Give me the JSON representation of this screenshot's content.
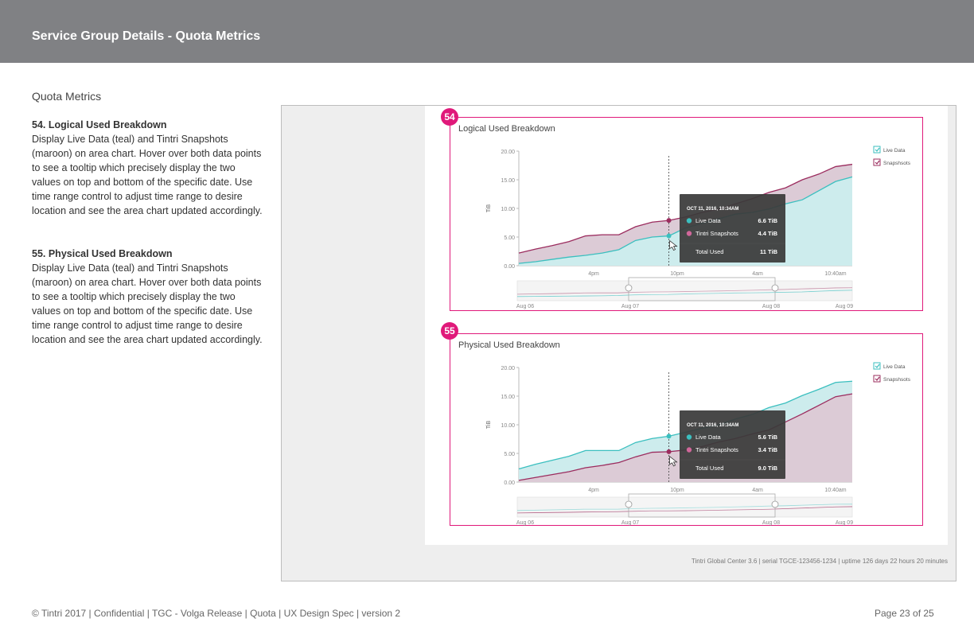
{
  "header": {
    "title": "Service Group Details - Quota Metrics"
  },
  "section_title": "Quota Metrics",
  "descriptions": [
    {
      "title": "54. Logical Used Breakdown",
      "body": "Display Live Data (teal) and Tintri Snapshots (maroon) on area chart. Hover over both data points to see a tooltip which precisely display the two values on top and bottom of the specific date. Use time range control to adjust time range to desire location and see the area chart updated accordingly."
    },
    {
      "title": "55. Physical Used Breakdown",
      "body": "Display Live Data (teal) and Tintri Snapshots (maroon) on area chart. Hover over both data points to see a tooltip which precisely display the two values on top and bottom of the specific date. Use time range control to adjust time range to desire location and see the area chart updated accordingly."
    }
  ],
  "colors": {
    "teal": "#3bbfbf",
    "teal_fill": "#cdeced",
    "maroon": "#9b2c5e",
    "maroon_fill": "#dccbd6",
    "accent": "#e0197a"
  },
  "charts": [
    {
      "badge": "54",
      "title": "Logical Used Breakdown",
      "ylabel": "TiB",
      "yticks": [
        "20.00",
        "15.00",
        "10.00",
        "5.00",
        "0.00"
      ],
      "xticks": [
        "4pm",
        "10pm",
        "4am",
        "10:40am"
      ],
      "nav_ticks": [
        "Aug 06",
        "Aug 07",
        "Aug 08",
        "Aug 09"
      ],
      "legend": [
        "Live Data",
        "Snapshsots"
      ],
      "tooltip": {
        "date": "OCT 11, 2016, 10:34AM",
        "rows": [
          {
            "label": "Live Data",
            "value": "6.6 TiB"
          },
          {
            "label": "Tintri Snapshots",
            "value": "4.4 TiB"
          }
        ],
        "total_label": "Total Used",
        "total_value": "11 TiB"
      }
    },
    {
      "badge": "55",
      "title": "Physical Used Breakdown",
      "ylabel": "TiB",
      "yticks": [
        "20.00",
        "15.00",
        "10.00",
        "5.00",
        "0.00"
      ],
      "xticks": [
        "4pm",
        "10pm",
        "4am",
        "10:40am"
      ],
      "nav_ticks": [
        "Aug 06",
        "Aug 07",
        "Aug 08",
        "Aug 09"
      ],
      "legend": [
        "Live Data",
        "Snapshsots"
      ],
      "tooltip": {
        "date": "OCT 11, 2016, 10:34AM",
        "rows": [
          {
            "label": "Live Data",
            "value": "5.6 TiB"
          },
          {
            "label": "Tintri Snapshots",
            "value": "3.4 TiB"
          }
        ],
        "total_label": "Total Used",
        "total_value": "9.0 TiB"
      }
    }
  ],
  "chart_data": [
    {
      "type": "area",
      "title": "Logical Used Breakdown",
      "ylabel": "TiB",
      "ylim": [
        0,
        20
      ],
      "x": [
        0,
        1,
        2,
        3,
        4,
        5,
        6,
        7,
        8,
        9,
        10,
        11,
        12,
        13,
        14,
        15,
        16,
        17,
        18,
        19,
        20
      ],
      "series": [
        {
          "name": "Live Data",
          "values": [
            0.4,
            0.7,
            1.1,
            1.5,
            1.8,
            2.2,
            2.8,
            4.4,
            5.0,
            5.2,
            6.6,
            7.4,
            8.2,
            9.0,
            9.3,
            9.9,
            10.8,
            11.5,
            13.1,
            14.7,
            15.5
          ]
        },
        {
          "name": "Snapshsots",
          "values": [
            2.2,
            2.9,
            3.5,
            4.2,
            5.2,
            5.4,
            5.4,
            6.8,
            7.6,
            7.9,
            8.5,
            9.3,
            9.9,
            10.8,
            11.7,
            12.8,
            13.6,
            15.0,
            16.0,
            17.3,
            17.7
          ]
        }
      ]
    },
    {
      "type": "area",
      "title": "Physical Used Breakdown",
      "ylabel": "TiB",
      "ylim": [
        0,
        20
      ],
      "x": [
        0,
        1,
        2,
        3,
        4,
        5,
        6,
        7,
        8,
        9,
        10,
        11,
        12,
        13,
        14,
        15,
        16,
        17,
        18,
        19,
        20
      ],
      "series": [
        {
          "name": "Live Data",
          "values": [
            2.3,
            3.1,
            3.8,
            4.5,
            5.5,
            5.5,
            5.5,
            6.9,
            7.6,
            8.0,
            8.7,
            9.4,
            10.0,
            11.0,
            11.8,
            13.0,
            13.8,
            15.1,
            16.2,
            17.4,
            17.6
          ]
        },
        {
          "name": "Snapshsots",
          "values": [
            0.3,
            0.8,
            1.3,
            1.8,
            2.5,
            2.9,
            3.4,
            4.4,
            5.2,
            5.3,
            5.6,
            6.2,
            7.0,
            7.6,
            8.4,
            9.1,
            10.5,
            11.9,
            13.4,
            14.9,
            15.4
          ]
        }
      ]
    }
  ],
  "mock_footer": "Tintri Global Center 3.6   |   serial TGCE-123456-1234   |   uptime 126 days 22 hours 20 minutes",
  "footer": {
    "left": "© Tintri 2017  | Confidential |  TGC - Volga Release  |  Quota  |  UX Design Spec  |  version 2",
    "right": "Page 23 of 25"
  }
}
